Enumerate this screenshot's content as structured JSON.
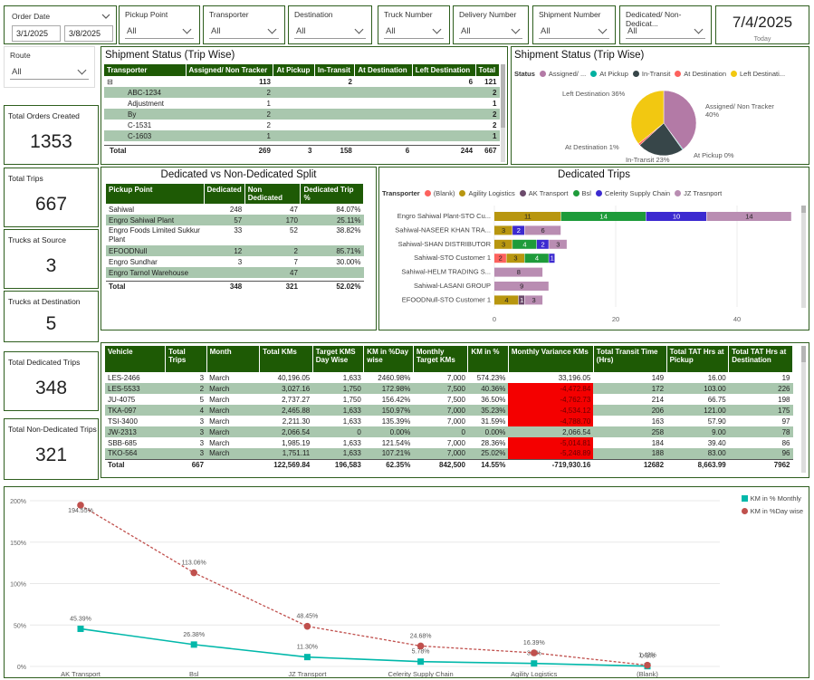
{
  "filters": {
    "order_date": {
      "label": "Order Date",
      "from": "3/1/2025",
      "to": "3/8/2025"
    },
    "pickup_point": {
      "label": "Pickup Point",
      "value": "All"
    },
    "transporter": {
      "label": "Transporter",
      "value": "All"
    },
    "destination": {
      "label": "Destination",
      "value": "All"
    },
    "truck_number": {
      "label": "Truck Number",
      "value": "All"
    },
    "delivery_number": {
      "label": "Delivery Number",
      "value": "All"
    },
    "shipment_number": {
      "label": "Shipment Number",
      "value": "All"
    },
    "dedicated": {
      "label": "Dedicated/ Non-Dedicat...",
      "value": "All"
    },
    "route": {
      "label": "Route",
      "value": "All"
    }
  },
  "today": {
    "date": "7/4/2025",
    "label": "Today"
  },
  "cards": [
    {
      "title": "Total Orders Created",
      "value": "1353"
    },
    {
      "title": "Total Trips",
      "value": "667"
    },
    {
      "title": "Trucks at Source",
      "value": "3"
    },
    {
      "title": "Trucks at Destination",
      "value": "5"
    },
    {
      "title": "Total Dedicated Trips",
      "value": "348"
    },
    {
      "title": "Total Non-Dedicated Trips",
      "value": "321"
    }
  ],
  "shipment_table": {
    "title": "Shipment Status (Trip Wise)",
    "columns": [
      "Transporter",
      "Assigned/ Non Tracker",
      "At Pickup",
      "In-Transit",
      "At Destination",
      "Left Destination",
      "Total"
    ],
    "group_row": [
      "⊟",
      "113",
      "",
      "2",
      "",
      "6",
      "121"
    ],
    "rows": [
      [
        "ABC-1234",
        "2",
        "",
        "",
        "",
        "",
        "2"
      ],
      [
        "Adjustment",
        "1",
        "",
        "",
        "",
        "",
        "1"
      ],
      [
        "By",
        "2",
        "",
        "",
        "",
        "",
        "2"
      ],
      [
        "C-1531",
        "2",
        "",
        "",
        "",
        "",
        "2"
      ],
      [
        "C-1603",
        "1",
        "",
        "",
        "",
        "",
        "1"
      ]
    ],
    "total": [
      "Total",
      "269",
      "3",
      "158",
      "6",
      "244",
      "667"
    ]
  },
  "shipment_pie": {
    "title": "Shipment Status (Trip Wise)",
    "legend_title": "Status",
    "legend": [
      {
        "name": "Assigned/ ...",
        "color": "#b37aa6"
      },
      {
        "name": "At Pickup",
        "color": "#00b0a0"
      },
      {
        "name": "In-Transit",
        "color": "#374649"
      },
      {
        "name": "At Destination",
        "color": "#fd625e"
      },
      {
        "name": "Left Destinati...",
        "color": "#f2c811"
      }
    ],
    "slices": [
      {
        "name": "Assigned/ Non Tracker",
        "pct": 40,
        "color": "#b37aa6",
        "label": "Assigned/ Non Tracker\n40%"
      },
      {
        "name": "At Pickup",
        "pct": 0.4,
        "color": "#00b0a0",
        "label": "At Pickup 0%"
      },
      {
        "name": "In-Transit",
        "pct": 23,
        "color": "#374649",
        "label": "In-Transit 23%"
      },
      {
        "name": "At Destination",
        "pct": 1,
        "color": "#fd625e",
        "label": "At Destination 1%"
      },
      {
        "name": "Left Destination",
        "pct": 36,
        "color": "#f2c811",
        "label": "Left Destination 36%"
      }
    ]
  },
  "split_table": {
    "title": "Dedicated vs Non-Dedicated Split",
    "columns": [
      "Pickup Point",
      "Dedicated",
      "Non Dedicated",
      "Dedicated Trip %"
    ],
    "rows": [
      [
        "Sahiwal",
        "248",
        "47",
        "84.07%"
      ],
      [
        "Engro Sahiwal Plant",
        "57",
        "170",
        "25.11%"
      ],
      [
        "Engro Foods Limited Sukkur Plant",
        "33",
        "52",
        "38.82%"
      ],
      [
        "EFOODNull",
        "12",
        "2",
        "85.71%"
      ],
      [
        "Engro Sundhar",
        "3",
        "7",
        "30.00%"
      ],
      [
        "Engro Tarnol Warehouse",
        "",
        "47",
        ""
      ]
    ],
    "total": [
      "Total",
      "348",
      "321",
      "52.02%"
    ]
  },
  "dedicated_trips": {
    "title": "Dedicated Trips",
    "legend_title": "Transporter",
    "legend": [
      {
        "name": "(Blank)",
        "color": "#fd625e"
      },
      {
        "name": "Agility Logistics",
        "color": "#b8960f"
      },
      {
        "name": "AK Transport",
        "color": "#6b4a6b"
      },
      {
        "name": "Bsl",
        "color": "#1e9b3a"
      },
      {
        "name": "Celerity Supply Chain",
        "color": "#3c2ad0"
      },
      {
        "name": "JZ Trasnport",
        "color": "#b98db2"
      }
    ],
    "axis_ticks": [
      "0",
      "20",
      "40"
    ],
    "chart_data": {
      "type": "bar",
      "orientation": "horizontal-stacked",
      "categories": [
        "Engro Sahiwal Plant-STO Cu...",
        "Sahiwal-NASEER KHAN TRA...",
        "Sahiwal-SHAN DISTRIBUTOR",
        "Sahiwal-STO Customer 1",
        "Sahiwal-HELM TRADING S...",
        "Sahiwal-LASANI GROUP",
        "EFOODNull-STO Customer 1"
      ],
      "series": [
        {
          "name": "(Blank)",
          "color": "#fd625e",
          "values": [
            0,
            0,
            0,
            2,
            0,
            0,
            0
          ]
        },
        {
          "name": "Agility Logistics",
          "color": "#b8960f",
          "values": [
            11,
            3,
            3,
            3,
            0,
            0,
            4
          ]
        },
        {
          "name": "AK Transport",
          "color": "#6b4a6b",
          "values": [
            0,
            0,
            0,
            0,
            0,
            0,
            1
          ]
        },
        {
          "name": "Bsl",
          "color": "#1e9b3a",
          "values": [
            14,
            0,
            4,
            4,
            0,
            0,
            0
          ]
        },
        {
          "name": "Celerity Supply Chain",
          "color": "#3c2ad0",
          "values": [
            10,
            2,
            2,
            1,
            0,
            0,
            0
          ]
        },
        {
          "name": "JZ Trasnport",
          "color": "#b98db2",
          "values": [
            14,
            6,
            3,
            0,
            8,
            9,
            3
          ]
        }
      ],
      "xlim": [
        0,
        50
      ]
    }
  },
  "vehicle_table": {
    "columns": [
      "Vehicle",
      "Total Trips",
      "Month",
      "Total KMs",
      "Target KMS Day Wise",
      "KM in %Day wise",
      "Monthly Target KMs",
      "KM in %",
      "Monthly Variance KMs",
      "Total Transit Time (Hrs)",
      "Total TAT Hrs at Pickup",
      "Total TAT Hrs at Destination"
    ],
    "rows": [
      [
        "LES-2466",
        "3",
        "March",
        "40,196.05",
        "1,633",
        "2460.98%",
        "7,000",
        "574.23%",
        "33,196.05",
        "149",
        "16.00",
        "19"
      ],
      [
        "LES-5533",
        "2",
        "March",
        "3,027.16",
        "1,750",
        "172.98%",
        "7,500",
        "40.36%",
        "-4,472.84",
        "172",
        "103.00",
        "226"
      ],
      [
        "JU-4075",
        "5",
        "March",
        "2,737.27",
        "1,750",
        "156.42%",
        "7,500",
        "36.50%",
        "-4,762.73",
        "214",
        "66.75",
        "198"
      ],
      [
        "TKA-097",
        "4",
        "March",
        "2,465.88",
        "1,633",
        "150.97%",
        "7,000",
        "35.23%",
        "-4,534.12",
        "206",
        "121.00",
        "175"
      ],
      [
        "TSI-3400",
        "3",
        "March",
        "2,211.30",
        "1,633",
        "135.39%",
        "7,000",
        "31.59%",
        "-4,788.70",
        "163",
        "57.90",
        "97"
      ],
      [
        "JW-2313",
        "3",
        "March",
        "2,066.54",
        "0",
        "0.00%",
        "0",
        "0.00%",
        "2,066.54",
        "258",
        "9.00",
        "78"
      ],
      [
        "SBB-685",
        "3",
        "March",
        "1,985.19",
        "1,633",
        "121.54%",
        "7,000",
        "28.36%",
        "-5,014.81",
        "184",
        "39.40",
        "86"
      ],
      [
        "TKO-564",
        "3",
        "March",
        "1,751.11",
        "1,633",
        "107.21%",
        "7,000",
        "25.02%",
        "-5,248.89",
        "188",
        "83.00",
        "96"
      ]
    ],
    "total": [
      "Total",
      "667",
      "",
      "122,569.84",
      "196,583",
      "62.35%",
      "842,500",
      "14.55%",
      "-719,930.16",
      "12682",
      "8,663.99",
      "7962"
    ]
  },
  "km_chart": {
    "legend": [
      {
        "name": "KM in % Monthly",
        "color": "#01b8aa"
      },
      {
        "name": "KM in %Day wise",
        "color": "#c0504d"
      }
    ],
    "y_ticks": [
      "0%",
      "50%",
      "100%",
      "150%",
      "200%"
    ],
    "chart_data": {
      "type": "line",
      "categories": [
        "AK Transport",
        "Bsl",
        "JZ Transport",
        "Celerity Supply Chain",
        "Agility Logistics",
        "(Blank)"
      ],
      "series": [
        {
          "name": "KM in % Monthly",
          "color": "#01b8aa",
          "values": [
            45.39,
            26.38,
            11.3,
            5.78,
            3.6,
            0.3
          ],
          "labels": [
            "45.39%",
            "26.38%",
            "11.30%",
            "5.78%",
            "3.6%",
            "0.3%"
          ]
        },
        {
          "name": "KM in %Day wise",
          "color": "#c0504d",
          "values": [
            194.55,
            113.06,
            48.45,
            24.68,
            16.39,
            1.42
          ],
          "labels": [
            "194.55%",
            "113.06%",
            "48.45%",
            "24.68%",
            "16.39%",
            "1.42%"
          ]
        }
      ],
      "ylim": [
        0,
        200
      ]
    }
  }
}
